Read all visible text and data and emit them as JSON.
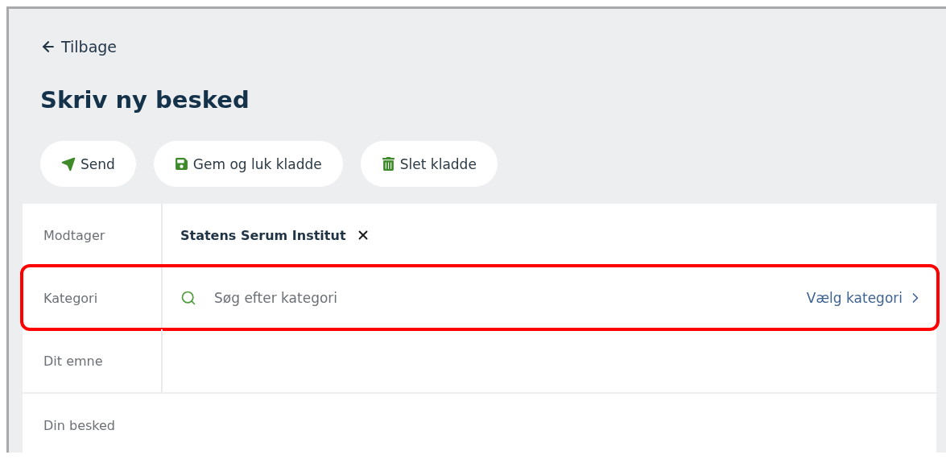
{
  "back_link": {
    "label": "Tilbage"
  },
  "title": "Skriv ny besked",
  "actions": [
    {
      "kind": "send",
      "label": "Send"
    },
    {
      "kind": "save",
      "label": "Gem og luk kladde"
    },
    {
      "kind": "delete",
      "label": "Slet kladde"
    }
  ],
  "fields": [
    {
      "kind": "recipient",
      "label": "Modtager",
      "value": "Statens Serum Institut",
      "highlighted": false
    },
    {
      "kind": "search",
      "label": "Kategori",
      "placeholder": "Søg efter kategori",
      "action": "Vælg kategori",
      "highlighted": true
    },
    {
      "kind": "text",
      "label": "Dit emne",
      "highlighted": false
    }
  ],
  "message": {
    "label": "Din besked"
  }
}
